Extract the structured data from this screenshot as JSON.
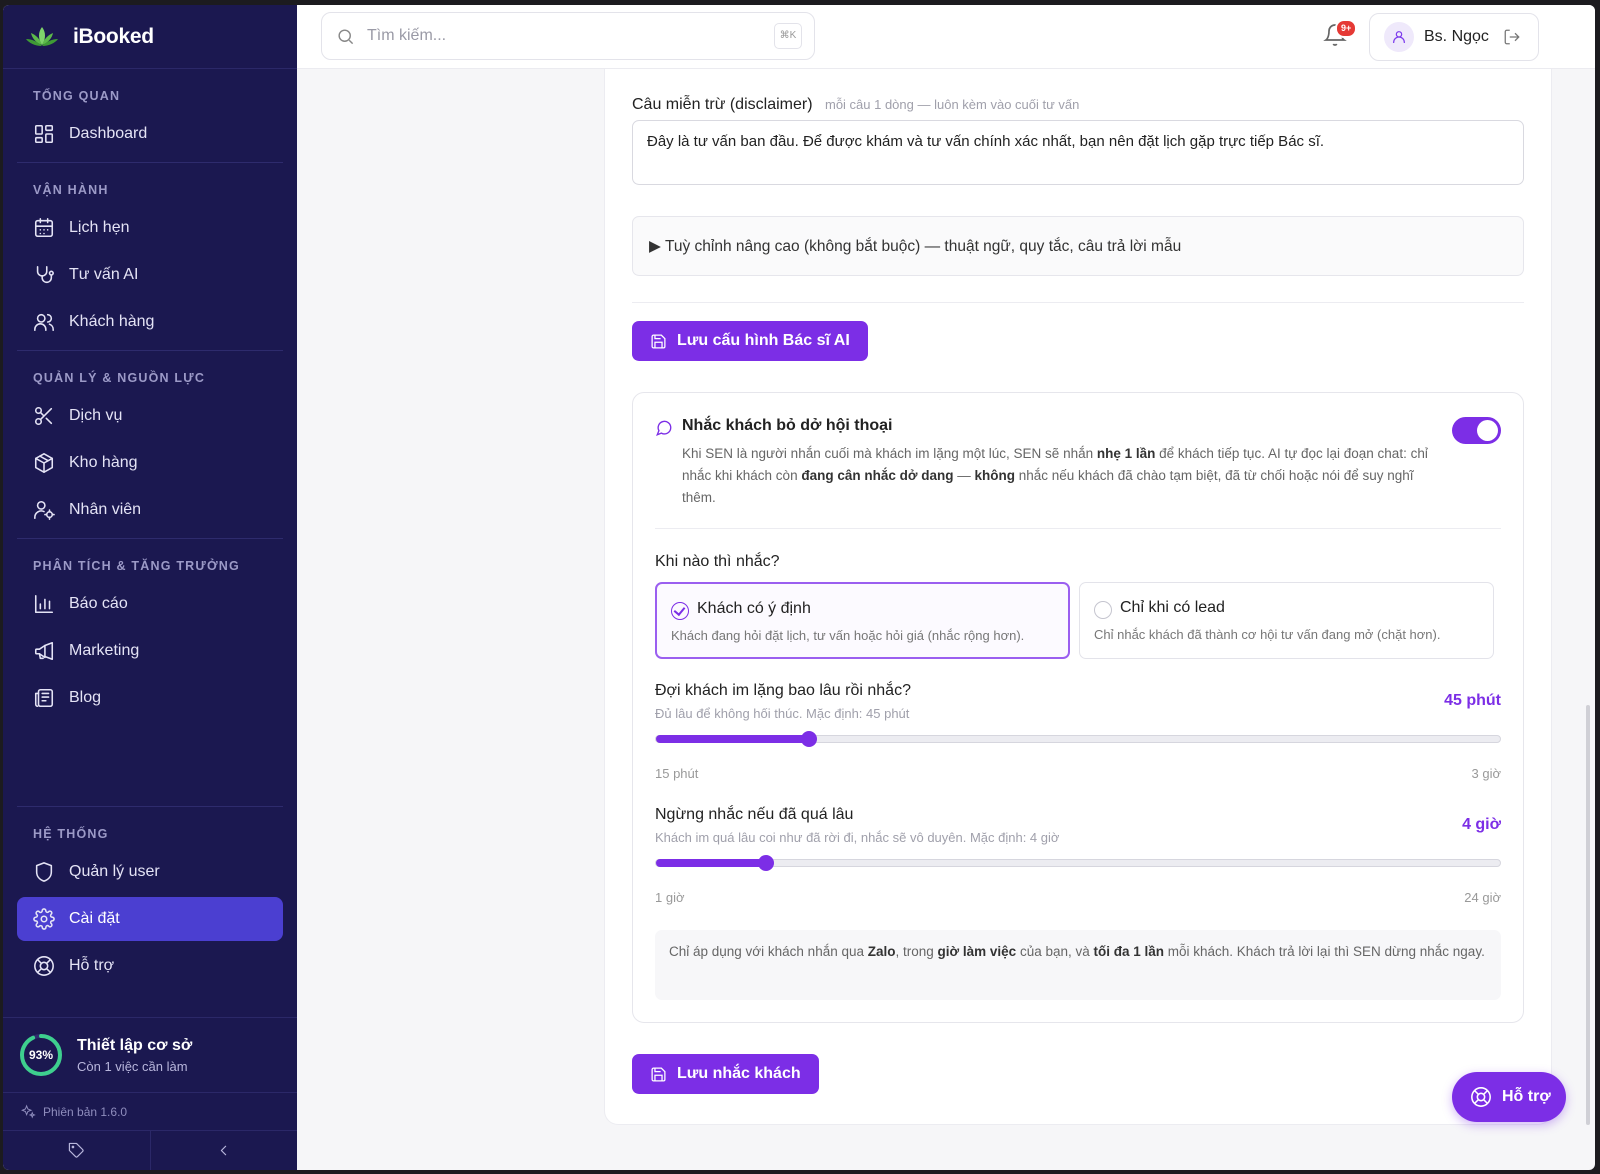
{
  "app": {
    "name": "iBooked"
  },
  "sidebar": {
    "sections": [
      {
        "title": "TỔNG QUAN",
        "items": [
          {
            "label": "Dashboard",
            "icon": "dashboard-icon"
          }
        ]
      },
      {
        "title": "VẬN HÀNH",
        "items": [
          {
            "label": "Lịch hẹn",
            "icon": "calendar-icon"
          },
          {
            "label": "Tư vấn AI",
            "icon": "stethoscope-icon"
          },
          {
            "label": "Khách hàng",
            "icon": "users-icon"
          }
        ]
      },
      {
        "title": "QUẢN LÝ & NGUỒN LỰC",
        "items": [
          {
            "label": "Dịch vụ",
            "icon": "scissors-icon"
          },
          {
            "label": "Kho hàng",
            "icon": "package-icon"
          },
          {
            "label": "Nhân viên",
            "icon": "user-cog-icon"
          }
        ]
      },
      {
        "title": "PHÂN TÍCH & TĂNG TRƯỞNG",
        "items": [
          {
            "label": "Báo cáo",
            "icon": "bar-chart-icon"
          },
          {
            "label": "Marketing",
            "icon": "megaphone-icon"
          },
          {
            "label": "Blog",
            "icon": "newspaper-icon"
          }
        ]
      },
      {
        "title": "HỆ THỐNG",
        "items": [
          {
            "label": "Quản lý user",
            "icon": "shield-icon"
          },
          {
            "label": "Cài đặt",
            "icon": "gear-icon",
            "active": true
          },
          {
            "label": "Hỗ trợ",
            "icon": "lifebuoy-icon"
          }
        ]
      }
    ],
    "setup": {
      "percent_label": "93%",
      "progress": 0.93,
      "title": "Thiết lập cơ sở",
      "subtitle": "Còn 1 việc cần làm"
    },
    "version": "Phiên bản 1.6.0"
  },
  "topbar": {
    "search_placeholder": "Tìm kiếm...",
    "search_shortcut": "⌘K",
    "notification_badge": "9+",
    "user_name": "Bs. Ngọc"
  },
  "ai_config": {
    "disclaimer_label": "Câu miễn trừ (disclaimer)",
    "disclaimer_hint": "mỗi câu 1 dòng — luôn kèm vào cuối tư vấn",
    "disclaimer_value": "Đây là tư vấn ban đầu. Để được khám và tư vấn chính xác nhất, bạn nên đặt lịch gặp trực tiếp Bác sĩ.",
    "advanced_summary": "▶ Tuỳ chỉnh nâng cao (không bắt buộc) — thuật ngữ, quy tắc, câu trả lời mẫu",
    "save_label": "Lưu cấu hình Bác sĩ AI"
  },
  "reminder": {
    "title": "Nhắc khách bỏ dở hội thoại",
    "enabled": true,
    "desc_parts": [
      "Khi SEN là người nhắn cuối mà khách im lặng một lúc, SEN sẽ nhắn ",
      "nhẹ 1 lần",
      " để khách tiếp tục. AI tự đọc lại đoạn chat: chỉ nhắc khi khách còn ",
      "đang cân nhắc dở dang",
      " — ",
      "không",
      " nhắc nếu khách đã chào tạm biệt, đã từ chối hoặc nói để suy nghĩ thêm."
    ],
    "when_label": "Khi nào thì nhắc?",
    "options": [
      {
        "title": "Khách có ý định",
        "desc": "Khách đang hỏi đặt lịch, tư vấn hoặc hỏi giá (nhắc rộng hơn).",
        "selected": true
      },
      {
        "title": "Chỉ khi có lead",
        "desc": "Chỉ nhắc khách đã thành cơ hội tư vấn đang mở (chặt hơn).",
        "selected": false
      }
    ],
    "wait": {
      "title": "Đợi khách im lặng bao lâu rồi nhắc?",
      "hint": "Đủ lâu để không hối thúc. Mặc định: 45 phút",
      "value_label": "45 phút",
      "min_label": "15 phút",
      "max_label": "3 giờ",
      "value": 45,
      "min": 15,
      "max": 180
    },
    "stop": {
      "title": "Ngừng nhắc nếu đã quá lâu",
      "hint": "Khách im quá lâu coi như đã rời đi, nhắc sẽ vô duyên. Mặc định: 4 giờ",
      "value_label": "4 giờ",
      "min_label": "1 giờ",
      "max_label": "24 giờ",
      "value": 4,
      "min": 1,
      "max": 24
    },
    "note_parts": [
      "Chỉ áp dụng với khách nhắn qua ",
      "Zalo",
      ", trong ",
      "giờ làm việc",
      " của bạn, và ",
      "tối đa 1 lần",
      " mỗi khách. Khách trả lời lại thì SEN dừng nhắc ngay."
    ],
    "save_label": "Lưu nhắc khách"
  },
  "help_button": "Hỗ trợ",
  "colors": {
    "accent": "#7c2ee6",
    "sidebar_bg": "#1b1850",
    "active_nav": "#4b3fd1"
  }
}
